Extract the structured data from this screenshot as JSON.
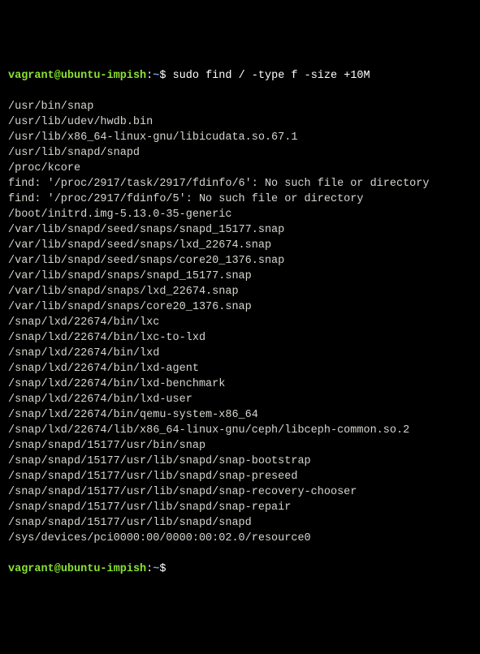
{
  "prompt1": {
    "user": "vagrant",
    "at": "@",
    "host": "ubuntu-impish",
    "colon": ":",
    "path": "~",
    "dollar": "$ ",
    "cmd": "sudo find / -type f -size +10M"
  },
  "output": [
    "/usr/bin/snap",
    "/usr/lib/udev/hwdb.bin",
    "/usr/lib/x86_64-linux-gnu/libicudata.so.67.1",
    "/usr/lib/snapd/snapd",
    "/proc/kcore",
    "find: '/proc/2917/task/2917/fdinfo/6': No such file or directory",
    "find: '/proc/2917/fdinfo/5': No such file or directory",
    "/boot/initrd.img-5.13.0-35-generic",
    "/var/lib/snapd/seed/snaps/snapd_15177.snap",
    "/var/lib/snapd/seed/snaps/lxd_22674.snap",
    "/var/lib/snapd/seed/snaps/core20_1376.snap",
    "/var/lib/snapd/snaps/snapd_15177.snap",
    "/var/lib/snapd/snaps/lxd_22674.snap",
    "/var/lib/snapd/snaps/core20_1376.snap",
    "/snap/lxd/22674/bin/lxc",
    "/snap/lxd/22674/bin/lxc-to-lxd",
    "/snap/lxd/22674/bin/lxd",
    "/snap/lxd/22674/bin/lxd-agent",
    "/snap/lxd/22674/bin/lxd-benchmark",
    "/snap/lxd/22674/bin/lxd-user",
    "/snap/lxd/22674/bin/qemu-system-x86_64",
    "/snap/lxd/22674/lib/x86_64-linux-gnu/ceph/libceph-common.so.2",
    "/snap/snapd/15177/usr/bin/snap",
    "/snap/snapd/15177/usr/lib/snapd/snap-bootstrap",
    "/snap/snapd/15177/usr/lib/snapd/snap-preseed",
    "/snap/snapd/15177/usr/lib/snapd/snap-recovery-chooser",
    "/snap/snapd/15177/usr/lib/snapd/snap-repair",
    "/snap/snapd/15177/usr/lib/snapd/snapd",
    "/sys/devices/pci0000:00/0000:00:02.0/resource0"
  ],
  "prompt2": {
    "user": "vagrant",
    "at": "@",
    "host": "ubuntu-impish",
    "colon": ":",
    "path": "~",
    "dollar": "$ ",
    "cmd": ""
  }
}
